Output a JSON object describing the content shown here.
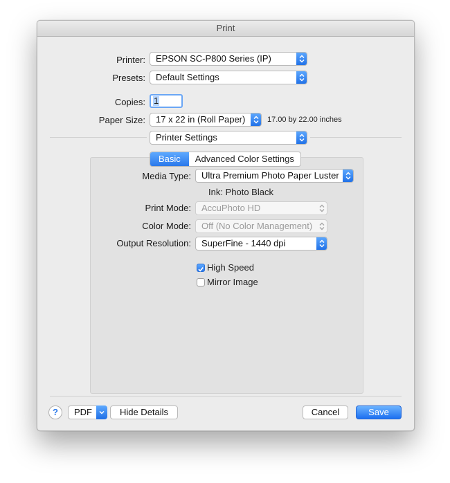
{
  "window": {
    "title": "Print"
  },
  "printer": {
    "label": "Printer:",
    "value": "EPSON SC-P800 Series (IP)"
  },
  "presets": {
    "label": "Presets:",
    "value": "Default Settings"
  },
  "copies": {
    "label": "Copies:",
    "value": "1"
  },
  "paper_size": {
    "label": "Paper Size:",
    "value": "17 x 22 in (Roll Paper)",
    "dimensions": "17.00 by 22.00 inches"
  },
  "section_menu": {
    "value": "Printer Settings"
  },
  "tabs": [
    {
      "label": "Basic",
      "selected": true
    },
    {
      "label": "Advanced Color Settings",
      "selected": false
    }
  ],
  "settings": {
    "media_type": {
      "label": "Media Type:",
      "value": "Ultra Premium Photo Paper Luster"
    },
    "ink": {
      "label": "Ink:",
      "value": "Photo Black"
    },
    "print_mode": {
      "label": "Print Mode:",
      "value": "AccuPhoto HD"
    },
    "color_mode": {
      "label": "Color Mode:",
      "value": "Off (No Color Management)"
    },
    "output_resolution": {
      "label": "Output Resolution:",
      "value": "SuperFine - 1440 dpi"
    },
    "high_speed": {
      "label": "High Speed",
      "checked": true
    },
    "mirror_image": {
      "label": "Mirror Image",
      "checked": false
    }
  },
  "footer": {
    "help": "?",
    "pdf": "PDF",
    "hide_details": "Hide Details",
    "cancel": "Cancel",
    "save": "Save"
  },
  "colors": {
    "accent": "#2a78ea"
  },
  "icons": {
    "popup_arrows": "updown-chevrons-icon",
    "pdf_menu": "chevron-down-icon",
    "checkbox": "checkmark-icon"
  }
}
